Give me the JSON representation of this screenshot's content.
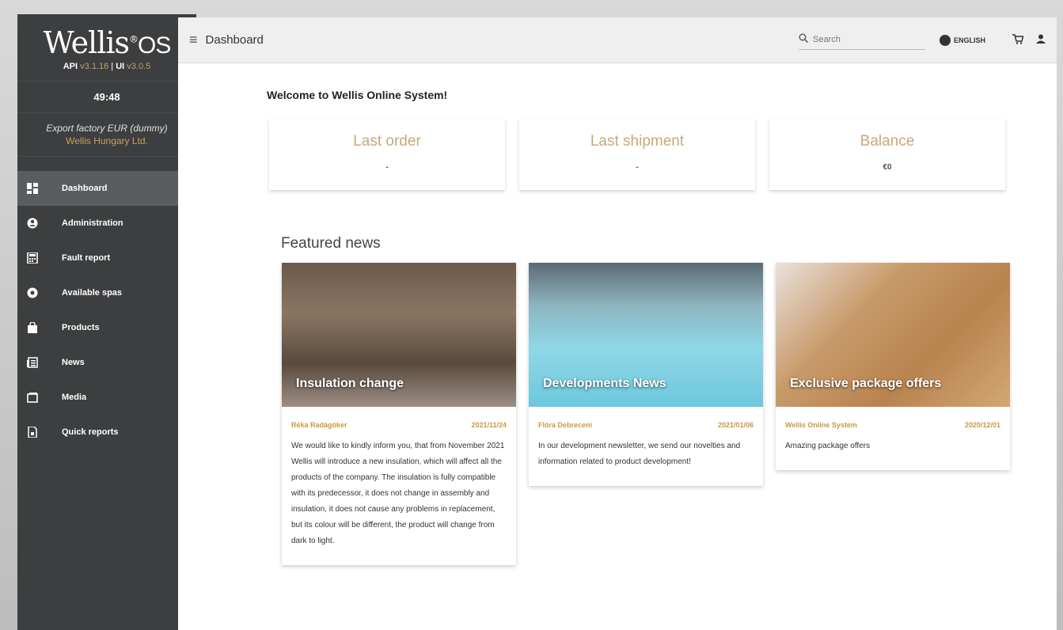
{
  "sidebar": {
    "logo_brand": "Wellis",
    "logo_suffix": "OS",
    "version_api_label": "API",
    "version_api": "v3.1.16",
    "version_ui_label": "UI",
    "version_ui": "v3.0.5",
    "timer": "49:48",
    "factory": "Export factory EUR (dummy)",
    "company": "Wellis Hungary Ltd.",
    "items": [
      {
        "label": "Dashboard",
        "icon": "dashboard-icon"
      },
      {
        "label": "Administration",
        "icon": "account-icon"
      },
      {
        "label": "Fault report",
        "icon": "calculator-icon"
      },
      {
        "label": "Available spas",
        "icon": "spa-icon"
      },
      {
        "label": "Products",
        "icon": "bag-icon"
      },
      {
        "label": "News",
        "icon": "news-icon"
      },
      {
        "label": "Media",
        "icon": "media-icon"
      },
      {
        "label": "Quick reports",
        "icon": "report-icon"
      }
    ]
  },
  "topbar": {
    "title": "Dashboard",
    "search_placeholder": "Search",
    "language": "ENGLISH"
  },
  "main": {
    "welcome": "Welcome to Wellis Online System!",
    "stats": [
      {
        "title": "Last order",
        "value": "-"
      },
      {
        "title": "Last shipment",
        "value": "-"
      },
      {
        "title": "Balance",
        "value": "€0"
      }
    ],
    "featured_title": "Featured news",
    "news": [
      {
        "caption": "Insulation change",
        "author": "Réka Radágóker",
        "date": "2021/11/24",
        "text": "We would like to kindly inform you, that from November 2021 Wellis will introduce a new insulation, which will affect all the products of the company. The insulation is fully compatible with its predecessor, it does not change in assembly and insulation, it does not cause any problems in replacement, but its colour will be different, the product will change from dark to light."
      },
      {
        "caption": "Developments News",
        "author": "Flóra Debreceni",
        "date": "2021/01/06",
        "text": "In our development newsletter, we send our novelties and information related to product development!"
      },
      {
        "caption": "Exclusive package offers",
        "author": "Wellis Online System",
        "date": "2020/12/01",
        "text": "Amazing package offers"
      }
    ]
  }
}
